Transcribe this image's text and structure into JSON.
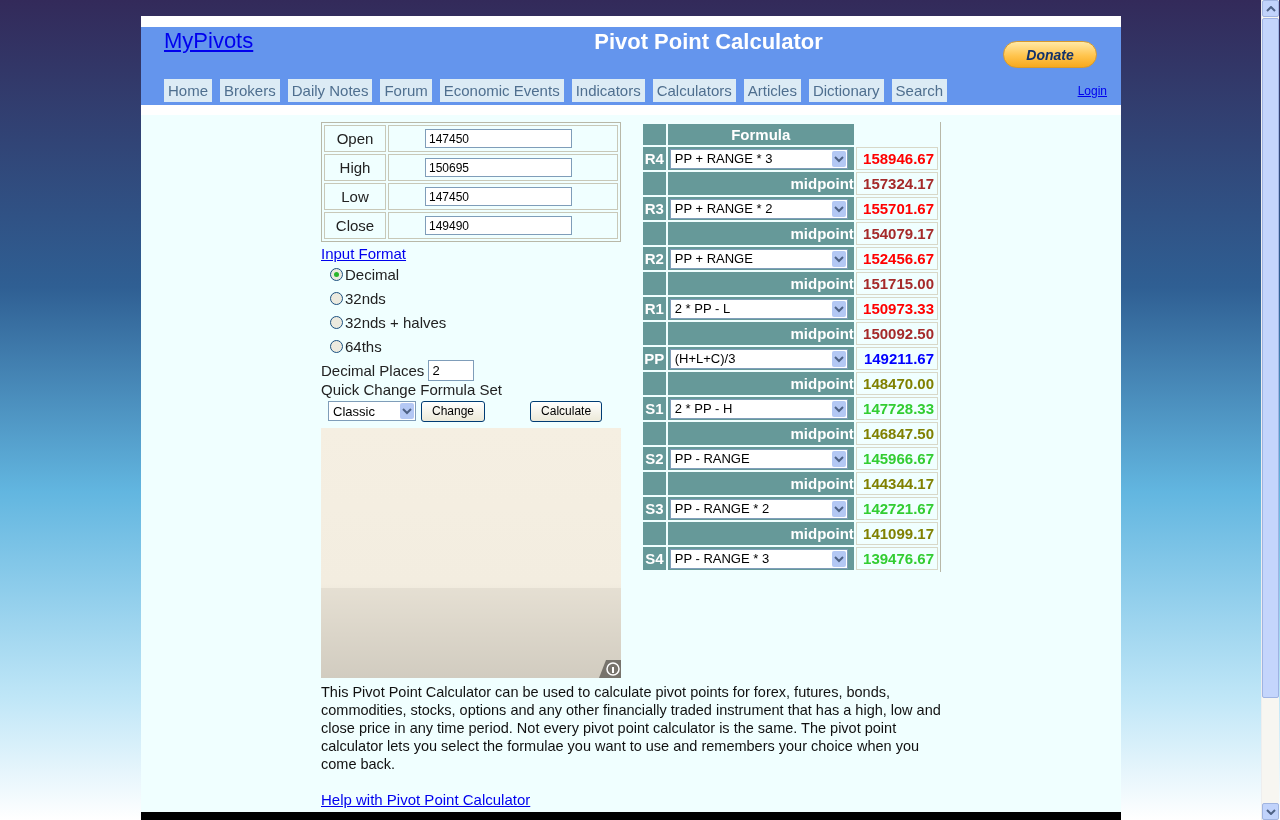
{
  "header": {
    "logo": "MyPivots",
    "title": "Pivot Point Calculator",
    "donate": "Donate",
    "login": "Login"
  },
  "nav": [
    "Home",
    "Brokers",
    "Daily Notes",
    "Forum",
    "Economic Events",
    "Indicators",
    "Calculators",
    "Articles",
    "Dictionary",
    "Search"
  ],
  "inputs": [
    {
      "label": "Open",
      "value": "147450"
    },
    {
      "label": "High",
      "value": "150695"
    },
    {
      "label": "Low",
      "value": "147450"
    },
    {
      "label": "Close",
      "value": "149490"
    }
  ],
  "input_format": {
    "link": "Input Format",
    "options": [
      {
        "label": "Decimal",
        "selected": true
      },
      {
        "label": "32nds",
        "selected": false
      },
      {
        "label": "32nds + halves",
        "selected": false
      },
      {
        "label": "64ths",
        "selected": false
      }
    ]
  },
  "decimal_places": {
    "label": "Decimal Places",
    "value": "2"
  },
  "formula_set": {
    "label": "Quick Change Formula Set",
    "value": "Classic",
    "change": "Change",
    "calculate": "Calculate"
  },
  "pivots": {
    "header": "Formula",
    "rows": [
      {
        "kind": "level",
        "name": "R4",
        "formula": "PP + RANGE * 3",
        "value": "158946.67",
        "color": "#ff0000"
      },
      {
        "kind": "midpoint",
        "label": "midpoint",
        "value": "157324.17",
        "color": "#a52a2a"
      },
      {
        "kind": "level",
        "name": "R3",
        "formula": "PP + RANGE * 2",
        "value": "155701.67",
        "color": "#ff0000"
      },
      {
        "kind": "midpoint",
        "label": "midpoint",
        "value": "154079.17",
        "color": "#a52a2a"
      },
      {
        "kind": "level",
        "name": "R2",
        "formula": "PP + RANGE",
        "value": "152456.67",
        "color": "#ff0000"
      },
      {
        "kind": "midpoint",
        "label": "midpoint",
        "value": "151715.00",
        "color": "#a52a2a"
      },
      {
        "kind": "level",
        "name": "R1",
        "formula": "2 * PP - L",
        "value": "150973.33",
        "color": "#ff0000"
      },
      {
        "kind": "midpoint",
        "label": "midpoint",
        "value": "150092.50",
        "color": "#a52a2a"
      },
      {
        "kind": "level",
        "name": "PP",
        "formula": "(H+L+C)/3",
        "value": "149211.67",
        "color": "#0000ff"
      },
      {
        "kind": "midpoint",
        "label": "midpoint",
        "value": "148470.00",
        "color": "#808000"
      },
      {
        "kind": "level",
        "name": "S1",
        "formula": "2 * PP - H",
        "value": "147728.33",
        "color": "#32cd32"
      },
      {
        "kind": "midpoint",
        "label": "midpoint",
        "value": "146847.50",
        "color": "#808000"
      },
      {
        "kind": "level",
        "name": "S2",
        "formula": "PP - RANGE",
        "value": "145966.67",
        "color": "#32cd32"
      },
      {
        "kind": "midpoint",
        "label": "midpoint",
        "value": "144344.17",
        "color": "#808000"
      },
      {
        "kind": "level",
        "name": "S3",
        "formula": "PP - RANGE * 2",
        "value": "142721.67",
        "color": "#32cd32"
      },
      {
        "kind": "midpoint",
        "label": "midpoint",
        "value": "141099.17",
        "color": "#808000"
      },
      {
        "kind": "level",
        "name": "S4",
        "formula": "PP - RANGE * 3",
        "value": "139476.67",
        "color": "#32cd32"
      }
    ]
  },
  "description": "This Pivot Point Calculator can be used to calculate pivot points for forex, futures, bonds, commodities, stocks, options and any other financially traded instrument that has a high, low and close price in any time period. Not every pivot point calculator is the same. The pivot point calculator lets you select the formulae you want to use and remembers your choice when you come back.",
  "help_link": "Help with Pivot Point Calculator"
}
